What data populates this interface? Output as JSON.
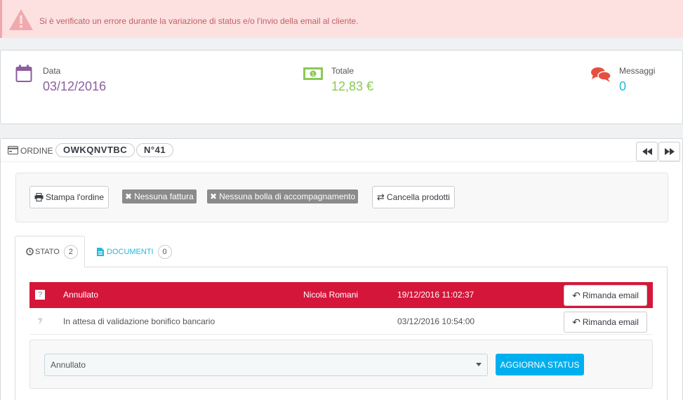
{
  "alert": {
    "message": "Si è verificato un errore durante la variazione di status e/o l'invio della email al cliente."
  },
  "kpi": {
    "date": {
      "label": "Data",
      "value": "03/12/2016",
      "color": "#8e5ea0"
    },
    "total": {
      "label": "Totale",
      "value": "12,83 €",
      "color": "#8bc954"
    },
    "messages": {
      "label": "Messaggi",
      "value": "0",
      "color": "#25b9d7"
    }
  },
  "order": {
    "title": "ORDINE",
    "reference": "OWKQNVTBC",
    "number": "N°41"
  },
  "actions": {
    "print": "Stampa l'ordine",
    "no_invoice": "Nessuna fattura",
    "no_delivery": "Nessuna bolla di accompagnamento",
    "cancel_products": "Cancella prodotti"
  },
  "tabs": {
    "status": {
      "label": "STATO",
      "count": "2"
    },
    "documents": {
      "label": "DOCUMENTI",
      "count": "0"
    }
  },
  "history": [
    {
      "status": "Annullato",
      "employee": "Nicola Romani",
      "date": "19/12/2016 11:02:37",
      "resend": "Rimanda email"
    },
    {
      "status": "In attesa di validazione bonifico bancario",
      "employee": "",
      "date": "03/12/2016 10:54:00",
      "resend": "Rimanda email"
    }
  ],
  "update": {
    "selected": "Annullato",
    "button": "AGGIORNA STATUS"
  },
  "colors": {
    "error_bg": "#fde1e1",
    "error_text": "#c25f63",
    "danger_row": "#d5163b",
    "primary": "#00aff0",
    "link": "#25b9d7"
  }
}
